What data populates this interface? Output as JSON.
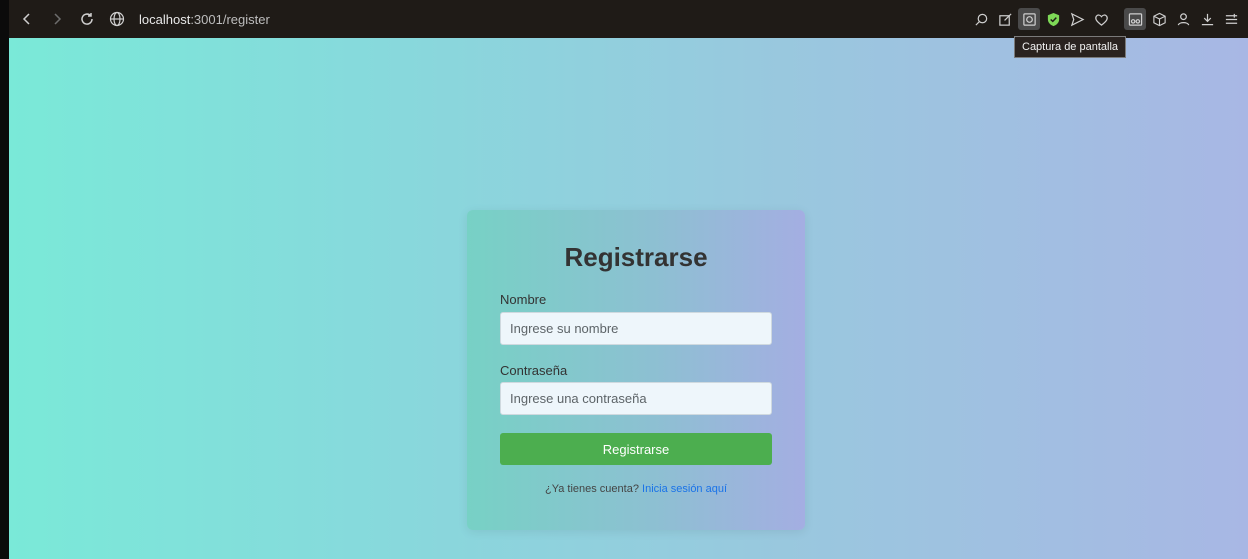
{
  "browser": {
    "url_host": "localhost",
    "url_path": ":3001/register",
    "tooltip": "Captura de pantalla",
    "toolbar_icons": [
      "search-icon",
      "edit-icon",
      "screenshot-icon",
      "shield-check-icon",
      "send-icon",
      "heart-icon",
      "reader-icon",
      "cube-icon",
      "profile-icon",
      "download-icon",
      "menu-icon"
    ]
  },
  "form": {
    "title": "Registrarse",
    "name_label": "Nombre",
    "name_placeholder": "Ingrese su nombre",
    "password_label": "Contraseña",
    "password_placeholder": "Ingrese una contraseña",
    "submit_label": "Registrarse",
    "footer_prefix": "¿Ya tienes cuenta?",
    "footer_link": "Inicia sesión aquí"
  },
  "colors": {
    "submit": "#4cae4f",
    "link": "#1a73e8"
  }
}
